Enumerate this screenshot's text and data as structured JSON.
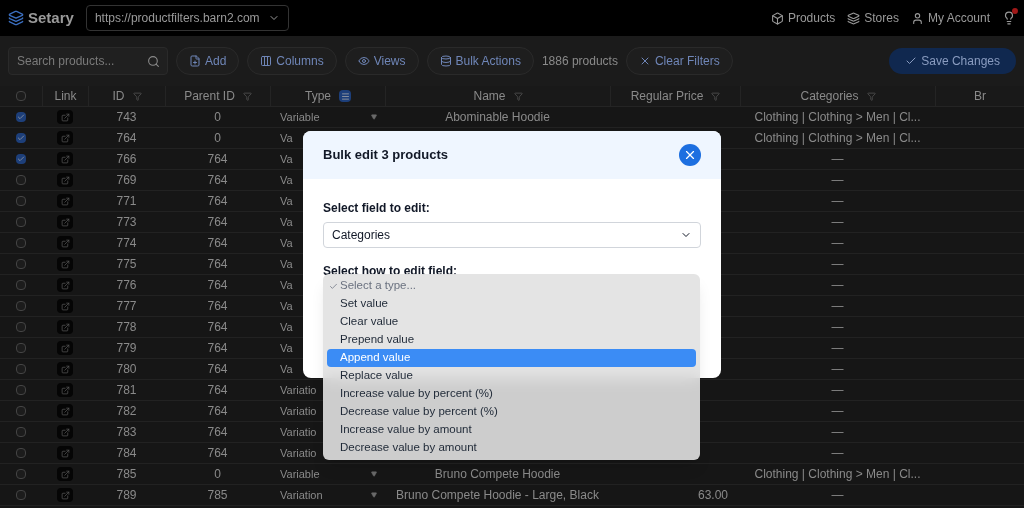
{
  "topbar": {
    "brand": "Setary",
    "store": "https://productfilters.barn2.com",
    "nav": [
      "Products",
      "Stores",
      "My Account"
    ],
    "notification": true
  },
  "toolbar": {
    "search": {
      "placeholder": "Search products..."
    },
    "buttons": [
      "Add",
      "Columns",
      "Views",
      "Bulk Actions"
    ],
    "count": "1886 products",
    "clear": "Clear Filters",
    "save": "Save Changes"
  },
  "table": {
    "all_checked": false,
    "columns": [
      {
        "label": "Link",
        "filter": false
      },
      {
        "label": "ID",
        "filter": true
      },
      {
        "label": "Parent ID",
        "filter": true
      },
      {
        "label": "Type",
        "filter": true,
        "active": true
      },
      {
        "label": "Name",
        "filter": true
      },
      {
        "label": "Regular Price",
        "filter": true
      },
      {
        "label": "Categories",
        "filter": true
      },
      {
        "label": "Br",
        "filter": false
      }
    ],
    "rows": [
      {
        "checked": true,
        "id": "743",
        "parent": "0",
        "type": "Variable",
        "name": "Abominable Hoodie",
        "categories": "Clothing | Clothing > Men | Cl..."
      },
      {
        "checked": true,
        "id": "764",
        "parent": "0",
        "type": "Va",
        "categories": "Clothing | Clothing > Men | Cl..."
      },
      {
        "checked": true,
        "id": "766",
        "parent": "764",
        "type": "Va",
        "categories": "—"
      },
      {
        "checked": false,
        "id": "769",
        "parent": "764",
        "type": "Va",
        "categories": "—"
      },
      {
        "checked": false,
        "id": "771",
        "parent": "764",
        "type": "Va",
        "categories": "—"
      },
      {
        "checked": false,
        "id": "773",
        "parent": "764",
        "type": "Va",
        "categories": "—"
      },
      {
        "checked": false,
        "id": "774",
        "parent": "764",
        "type": "Va",
        "categories": "—"
      },
      {
        "checked": false,
        "id": "775",
        "parent": "764",
        "type": "Va",
        "categories": "—"
      },
      {
        "checked": false,
        "id": "776",
        "parent": "764",
        "type": "Va",
        "categories": "—"
      },
      {
        "checked": false,
        "id": "777",
        "parent": "764",
        "type": "Va",
        "categories": "—"
      },
      {
        "checked": false,
        "id": "778",
        "parent": "764",
        "type": "Va",
        "categories": "—"
      },
      {
        "checked": false,
        "id": "779",
        "parent": "764",
        "type": "Va",
        "categories": "—"
      },
      {
        "checked": false,
        "id": "780",
        "parent": "764",
        "type": "Va",
        "categories": "—"
      },
      {
        "checked": false,
        "id": "781",
        "parent": "764",
        "type": "Variatio",
        "categories": "—"
      },
      {
        "checked": false,
        "id": "782",
        "parent": "764",
        "type": "Variatio",
        "categories": "—"
      },
      {
        "checked": false,
        "id": "783",
        "parent": "764",
        "type": "Variatio",
        "categories": "—"
      },
      {
        "checked": false,
        "id": "784",
        "parent": "764",
        "type": "Variatio",
        "categories": "—"
      },
      {
        "checked": false,
        "id": "785",
        "parent": "0",
        "type": "Variable",
        "name": "Bruno Compete Hoodie",
        "categories": "Clothing | Clothing > Men | Cl..."
      },
      {
        "checked": false,
        "id": "789",
        "parent": "785",
        "type": "Variation",
        "name": "Bruno Compete Hoodie - Large, Black",
        "price": "63.00",
        "categories": "—"
      }
    ]
  },
  "modal": {
    "title": "Bulk edit 3 products",
    "field_label": "Select field to edit:",
    "field_value": "Categories",
    "how_label": "Select how to edit field:",
    "options": [
      {
        "label": "Select a type...",
        "selected": true,
        "disabled": true,
        "highlighted": false
      },
      {
        "label": "Set value",
        "selected": false,
        "disabled": false,
        "highlighted": false
      },
      {
        "label": "Clear value",
        "selected": false,
        "disabled": false,
        "highlighted": false
      },
      {
        "label": "Prepend value",
        "selected": false,
        "disabled": false,
        "highlighted": false
      },
      {
        "label": "Append value",
        "selected": false,
        "disabled": false,
        "highlighted": true
      },
      {
        "label": "Replace value",
        "selected": false,
        "disabled": false,
        "highlighted": false
      },
      {
        "label": "Increase value by percent (%)",
        "selected": false,
        "disabled": false,
        "highlighted": false
      },
      {
        "label": "Decrease value by percent (%)",
        "selected": false,
        "disabled": false,
        "highlighted": false
      },
      {
        "label": "Increase value by amount",
        "selected": false,
        "disabled": false,
        "highlighted": false
      },
      {
        "label": "Decrease value by amount",
        "selected": false,
        "disabled": false,
        "highlighted": false
      }
    ]
  }
}
